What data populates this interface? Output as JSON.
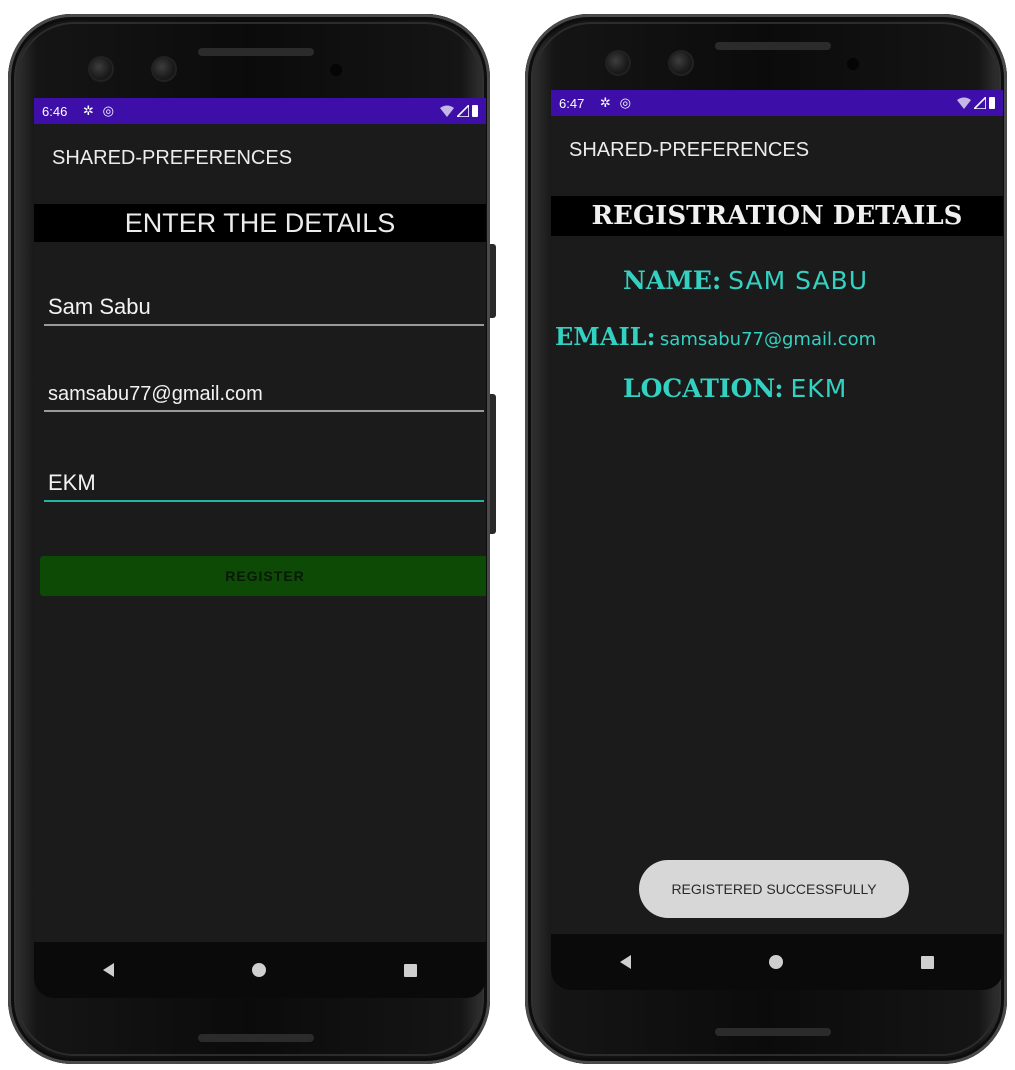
{
  "left_screen": {
    "status": {
      "time": "6:46"
    },
    "app_title": "SHARED-PREFERENCES",
    "heading": "ENTER THE DETAILS",
    "fields": {
      "name_value": "Sam Sabu",
      "email_value": "samsabu77@gmail.com",
      "location_value": "EKM"
    },
    "register_label": "REGISTER"
  },
  "right_screen": {
    "status": {
      "time": "6:47"
    },
    "app_title": "SHARED-PREFERENCES",
    "heading": "REGISTRATION DETAILS",
    "name_label": "NAME:",
    "name_value": "SAM SABU",
    "email_label": "EMAIL:",
    "email_value": "samsabu77@gmail.com",
    "location_label": "LOCATION:",
    "location_value": "EKM",
    "toast": "REGISTERED SUCCESSFULLY"
  },
  "icons": {
    "status": [
      "gear-icon",
      "data-saver-icon",
      "wifi-icon",
      "signal-icon",
      "battery-icon"
    ],
    "navigation": [
      "back-icon",
      "home-icon",
      "recents-icon"
    ]
  },
  "colors": {
    "status_bar": "#3d0fa8",
    "screen_background": "#1b1b1c",
    "register_button": "#0c4a06",
    "accent_teal": "#33d1c1",
    "toast_background": "#d7d7d7"
  }
}
